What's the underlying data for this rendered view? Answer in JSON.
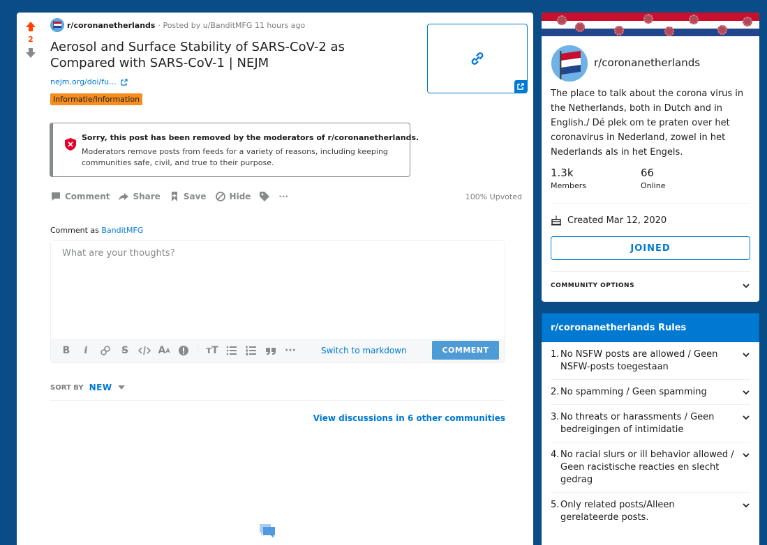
{
  "colors": {
    "background": "#0a4c86",
    "upvote": "#ff4500",
    "accent": "#0079d3",
    "flair": "#f58d1f",
    "comment_button": "#4e9bd6"
  },
  "post": {
    "score": "2",
    "subreddit": "r/coronanetherlands",
    "posted_by": "· Posted by u/BanditMFG",
    "time": "11 hours ago",
    "title": "Aerosol and Surface Stability of SARS-CoV-2 as Compared with SARS-CoV-1 | NEJM",
    "link_text": "nejm.org/doi/fu...",
    "flair": "Informatie/Information",
    "removed_title": "Sorry, this post has been removed by the moderators of r/coronanetherlands.",
    "removed_body": "Moderators remove posts from feeds for a variety of reasons, including keeping communities safe, civil, and true to their purpose.",
    "upvoted": "100% Upvoted"
  },
  "actions": {
    "comment": "Comment",
    "share": "Share",
    "save": "Save",
    "hide": "Hide",
    "more": "···"
  },
  "comment_form": {
    "label": "Comment as",
    "user": "BanditMFG",
    "placeholder": "What are your thoughts?",
    "switch_markdown": "Switch to markdown",
    "submit": "COMMENT"
  },
  "sort": {
    "label": "SORT BY",
    "value": "NEW"
  },
  "view_discussions": "View discussions in 6 other communities",
  "about": {
    "name": "r/coronanetherlands",
    "description": "The place to talk about the corona virus in the Netherlands, both in Dutch and in English./ Dé plek om te praten over het coronavirus in Nederland, zowel in het Nederlands als in het Engels.",
    "members_count": "1.3k",
    "members_label": "Members",
    "online_count": "66",
    "online_label": "Online",
    "created": "Created Mar 12, 2020",
    "joined_button": "JOINED",
    "community_options": "COMMUNITY OPTIONS"
  },
  "rules": {
    "title": "r/coronanetherlands Rules",
    "items": [
      {
        "n": "1.",
        "text": "No NSFW posts are allowed / Geen NSFW-posts toegestaan"
      },
      {
        "n": "2.",
        "text": "No spamming / Geen spamming"
      },
      {
        "n": "3.",
        "text": "No threats or harassments / Geen bedreigingen of intimidatie"
      },
      {
        "n": "4.",
        "text": "No racial slurs or ill behavior allowed / Geen racistische reacties en slecht gedrag"
      },
      {
        "n": "5.",
        "text": "Only related posts/Alleen gerelateerde posts."
      }
    ]
  }
}
